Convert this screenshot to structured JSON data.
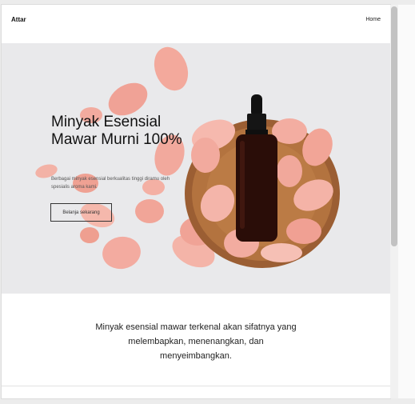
{
  "navbar": {
    "brand": "Attar",
    "links": [
      {
        "label": "Home"
      }
    ]
  },
  "hero": {
    "title": "Minyak Esensial Mawar Murni 100%",
    "subtitle": "Berbagai minyak esensial berkualitas tinggi diramu oleh spesialis aroma kami.",
    "cta_label": "Belanja sekarang"
  },
  "about": {
    "text": "Minyak esensial mawar terkenal akan sifatnya yang melembapkan, menenangkan, dan menyeimbangkan."
  },
  "colors": {
    "petal": "#f4aba0",
    "tray": "#a8683a",
    "bottle": "#2a0d08",
    "background": "#e9e9eb"
  },
  "scrollbar": {
    "position_fraction": 0
  }
}
